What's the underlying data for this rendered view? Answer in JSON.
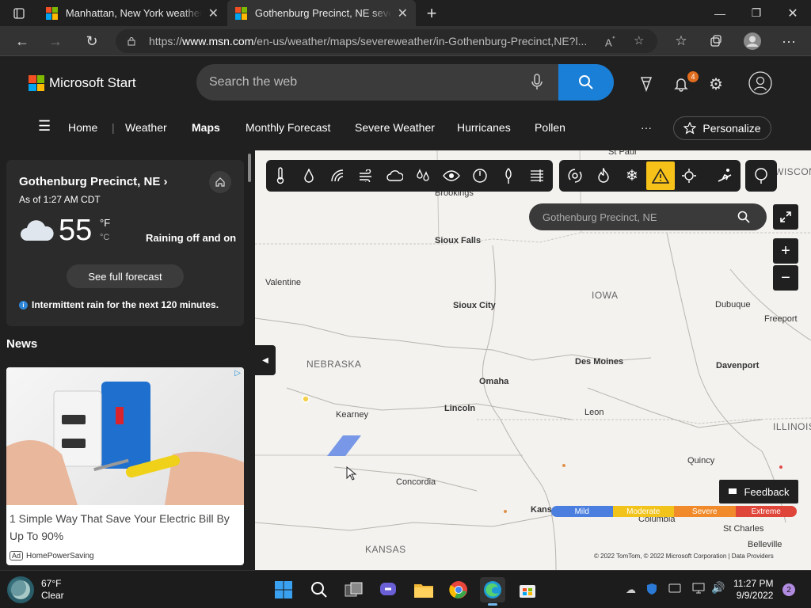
{
  "browser": {
    "tabs": [
      {
        "title": "Manhattan, New York weather fo",
        "active": false
      },
      {
        "title": "Gothenburg Precinct, NE severe",
        "active": true
      }
    ],
    "url_prefix": "https://",
    "url_host": "www.msn.com",
    "url_path": "/en-us/weather/maps/severeweather/in-Gothenburg-Precinct,NE?l..."
  },
  "msn": {
    "brand": "Microsoft Start",
    "search_placeholder": "Search the web",
    "notification_count": "4",
    "nav": [
      "Home",
      "Weather",
      "Maps",
      "Monthly Forecast",
      "Severe Weather",
      "Hurricanes",
      "Pollen"
    ],
    "more": "···",
    "personalize": "Personalize"
  },
  "weather_card": {
    "location": "Gothenburg Precinct, NE",
    "as_of": "As of 1:27 AM CDT",
    "temperature": "55",
    "unit_f": "°F",
    "unit_c": "°C",
    "condition": "Raining off and on",
    "full_forecast": "See full forecast",
    "rain_note": "Intermittent rain for the next 120 minutes."
  },
  "news": {
    "heading": "News",
    "ad_headline": "1 Simple Way That Save Your Electric Bill By Up To 90%",
    "ad_tag": "Ad",
    "ad_source": "HomePowerSaving"
  },
  "map": {
    "search_value": "Gothenburg Precinct, NE",
    "cities": [
      "St Paul",
      "Brookings",
      "Sioux Falls",
      "Valentine",
      "Sioux City",
      "Dubuque",
      "Freeport",
      "Des Moines",
      "Davenport",
      "Omaha",
      "Kearney",
      "Lincoln",
      "Leon",
      "Concordia",
      "Quincy",
      "Kansas City",
      "Columbia",
      "St Charles",
      "Belleville"
    ],
    "states": [
      "IOWA",
      "NEBRASKA",
      "KANSAS",
      "ILLINOIS",
      "WISCONSIN"
    ],
    "feedback": "Feedback",
    "legend": [
      {
        "label": "Mild",
        "color": "#4a7fe0"
      },
      {
        "label": "Moderate",
        "color": "#f2c31b"
      },
      {
        "label": "Severe",
        "color": "#f08a2a"
      },
      {
        "label": "Extreme",
        "color": "#e0453a"
      }
    ],
    "copyright": "© 2022 TomTom, © 2022 Microsoft Corporation | Data Providers"
  },
  "taskbar": {
    "weather_temp": "67°F",
    "weather_cond": "Clear",
    "time": "11:27 PM",
    "date": "9/9/2022",
    "notification_count": "2"
  }
}
